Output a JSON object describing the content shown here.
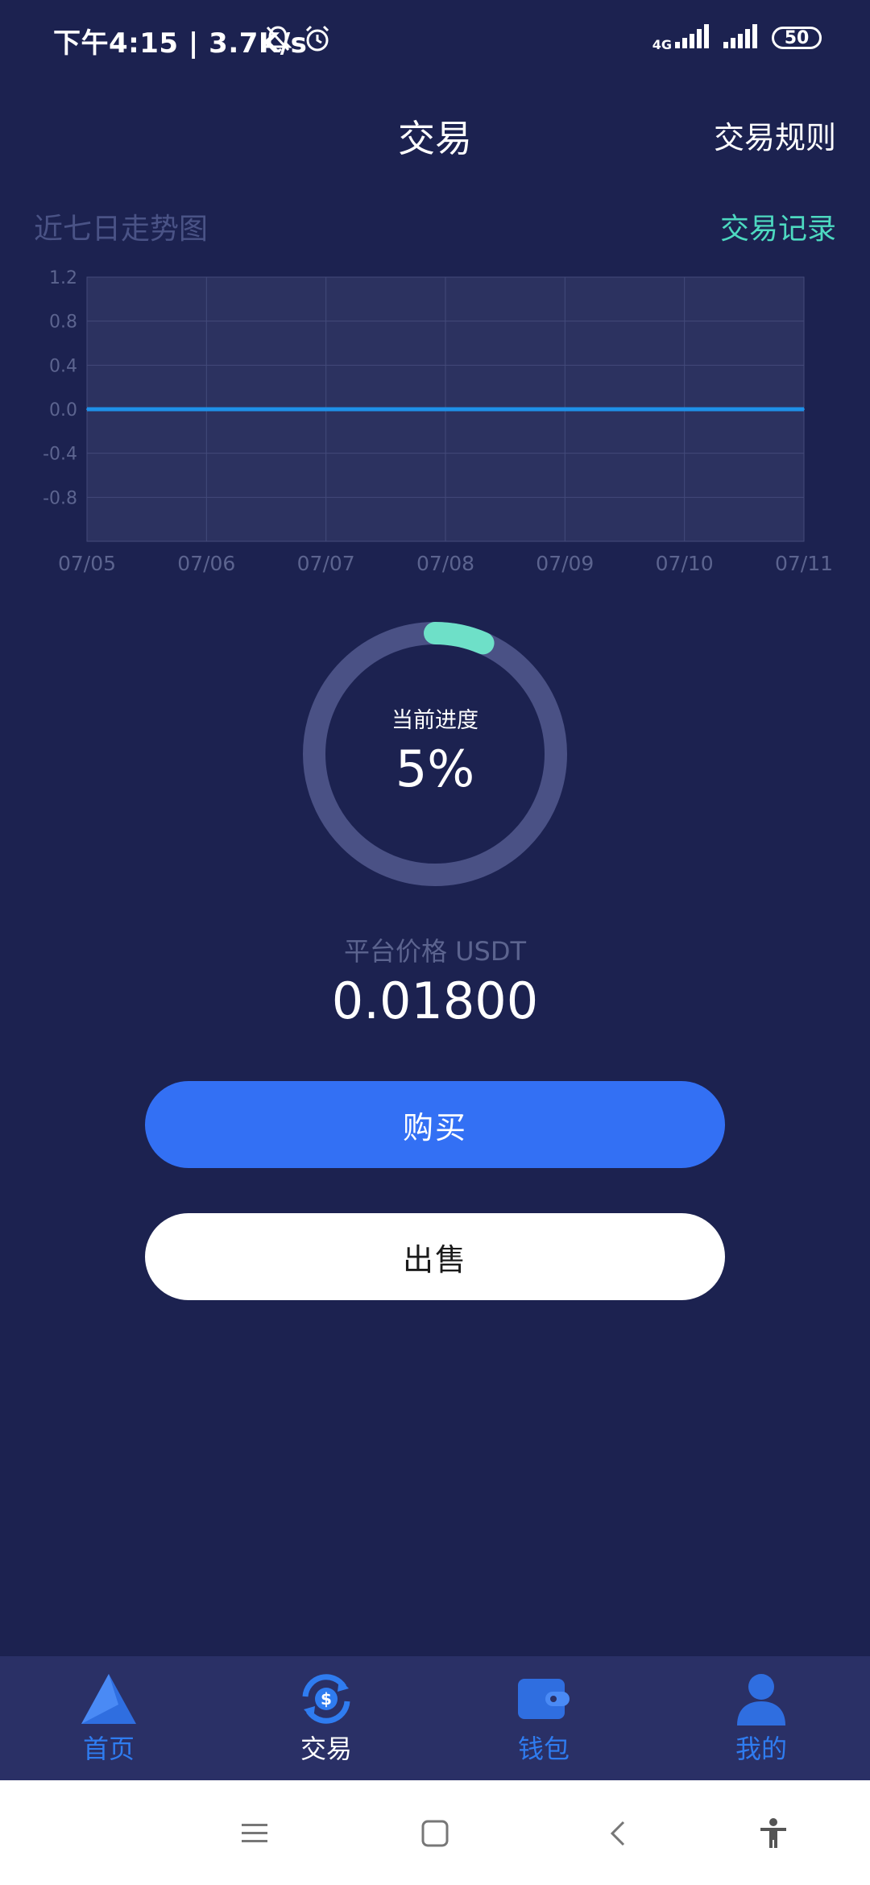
{
  "status_bar": {
    "time_speed": "下午4:15 | 3.7K/s",
    "network": "4G",
    "battery": "50"
  },
  "header": {
    "title": "交易",
    "rules_link": "交易规则"
  },
  "chart_section": {
    "title": "近七日走势图",
    "records_link": "交易记录"
  },
  "chart_data": {
    "type": "line",
    "x": [
      "07/05",
      "07/06",
      "07/07",
      "07/08",
      "07/09",
      "07/10",
      "07/11"
    ],
    "series": [
      {
        "values": [
          0,
          0,
          0,
          0,
          0,
          0,
          0
        ],
        "color": "#1e90e8"
      }
    ],
    "yticks": [
      "1.2",
      "0.8",
      "0.4",
      "0.0",
      "-0.4",
      "-0.8"
    ],
    "ylim": [
      -1.2,
      1.2
    ],
    "grid": true,
    "xlabel": "",
    "ylabel": ""
  },
  "progress": {
    "label": "当前进度",
    "value_text": "5%",
    "value": 0.05
  },
  "price": {
    "label": "平台价格 USDT",
    "value": "0.01800"
  },
  "actions": {
    "buy": "购买",
    "sell": "出售"
  },
  "bottom_nav": {
    "items": [
      {
        "label": "首页",
        "icon": "home-triangle-icon"
      },
      {
        "label": "交易",
        "icon": "exchange-dollar-icon",
        "active": true
      },
      {
        "label": "钱包",
        "icon": "wallet-icon"
      },
      {
        "label": "我的",
        "icon": "user-icon"
      }
    ]
  },
  "colors": {
    "background": "#1c2250",
    "accent_blue": "#3370f4",
    "accent_teal": "#4dd9c0",
    "nav_bg": "#2a3066"
  }
}
